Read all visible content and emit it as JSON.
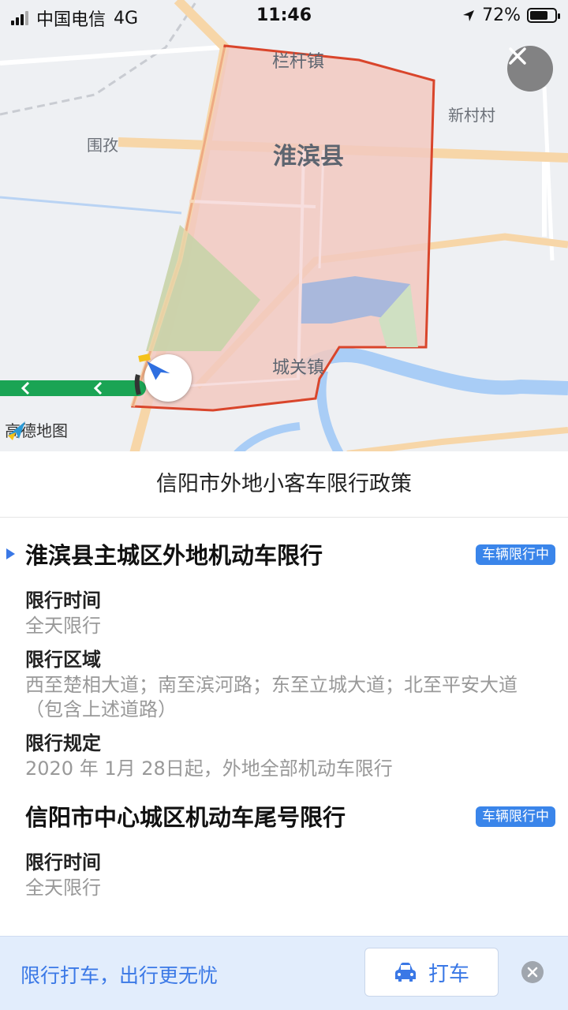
{
  "status_bar": {
    "carrier": "中国电信",
    "network": "4G",
    "time": "11:46",
    "battery": "72%",
    "battery_level": 0.72
  },
  "map": {
    "labels": {
      "langanzhen": "栏杆镇",
      "xincuncun": "新村村",
      "weizi": "围孜",
      "huaibinxian": "淮滨县",
      "chengguanzhen": "城关镇"
    },
    "logo_text": "高德地图",
    "region_color": "#f2c9c0",
    "border_color": "#d9452b",
    "route_color": "#1aa454"
  },
  "sheet": {
    "title": "信阳市外地小客车限行政策",
    "policies": [
      {
        "name": "淮滨县主城区外地机动车限行",
        "badge": "车辆限行中",
        "fields": [
          {
            "label": "限行时间",
            "value": "全天限行"
          },
          {
            "label": "限行区域",
            "value": "西至楚相大道；南至滨河路；东至立城大道；北至平安大道（包含上述道路）"
          },
          {
            "label": "限行规定",
            "value": "2020 年 1月 28日起，外地全部机动车限行"
          }
        ]
      },
      {
        "name": "信阳市中心城区机动车尾号限行",
        "badge": "车辆限行中",
        "fields": [
          {
            "label": "限行时间",
            "value": "全天限行"
          }
        ]
      }
    ]
  },
  "banner": {
    "text": "限行打车，出行更无忧",
    "taxi_button": "打车"
  },
  "colors": {
    "accent": "#3a78e6",
    "badge": "#3a85ea"
  }
}
